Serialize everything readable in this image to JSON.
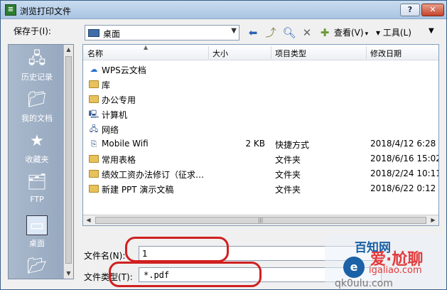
{
  "window": {
    "title": "浏览打印文件",
    "help_label": "?",
    "close_label": "✕"
  },
  "toolbar": {
    "save_in_label": "保存于(I):",
    "save_in_value": "桌面",
    "view_label": "查看(V)",
    "tools_label": "工具(L)"
  },
  "places": [
    {
      "label": "历史记录",
      "icon": "history-icon"
    },
    {
      "label": "我的文档",
      "icon": "documents-icon"
    },
    {
      "label": "收藏夹",
      "icon": "favorites-icon"
    },
    {
      "label": "FTP",
      "icon": "ftp-icon"
    },
    {
      "label": "桌面",
      "icon": "desktop-icon"
    }
  ],
  "file_list": {
    "columns": {
      "name": "名称",
      "size": "大小",
      "type": "项目类型",
      "date": "修改日期"
    },
    "rows": [
      {
        "name": "WPS云文档",
        "size": "",
        "type": "",
        "date": "",
        "icon": "cloud-icon"
      },
      {
        "name": "库",
        "size": "",
        "type": "",
        "date": "",
        "icon": "library-icon"
      },
      {
        "name": "办公专用",
        "size": "",
        "type": "",
        "date": "",
        "icon": "user-folder-icon"
      },
      {
        "name": "计算机",
        "size": "",
        "type": "",
        "date": "",
        "icon": "computer-icon"
      },
      {
        "name": "网络",
        "size": "",
        "type": "",
        "date": "",
        "icon": "network-icon"
      },
      {
        "name": "Mobile Wifi",
        "size": "2 KB",
        "type": "快捷方式",
        "date": "2018/4/12 6:28",
        "icon": "shortcut-icon"
      },
      {
        "name": "常用表格",
        "size": "",
        "type": "文件夹",
        "date": "2018/6/16 15:02",
        "icon": "folder-icon"
      },
      {
        "name": "绩效工资办法修订（征求…",
        "size": "",
        "type": "文件夹",
        "date": "2018/2/24 10:11",
        "icon": "folder-icon"
      },
      {
        "name": "新建 PPT 演示文稿",
        "size": "",
        "type": "文件夹",
        "date": "2018/6/22 0:12",
        "icon": "folder-icon"
      }
    ]
  },
  "form": {
    "filename_label": "文件名(N):",
    "filename_value": "1",
    "filetype_label": "文件类型(T):",
    "filetype_value": "*.pdf"
  },
  "watermark": {
    "top": "百知网",
    "main": "爱·尬聊",
    "url": "igaliao.com",
    "bottom": "qk0ulu.com"
  },
  "colors": {
    "annotation": "#d02020",
    "title_bar": "#a9c4e2",
    "places_bar": "#93a6be"
  }
}
